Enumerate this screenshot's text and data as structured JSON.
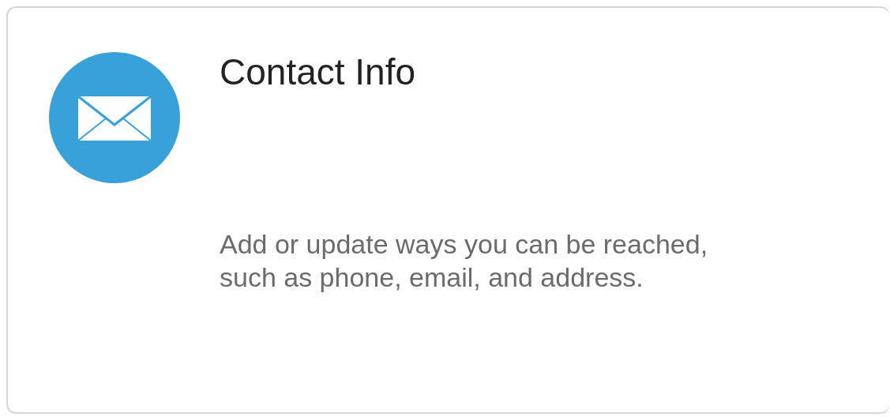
{
  "card": {
    "title": "Contact Info",
    "description_lines": [
      "Add or update ways you can be reached,",
      "such as phone, email, and address."
    ]
  }
}
